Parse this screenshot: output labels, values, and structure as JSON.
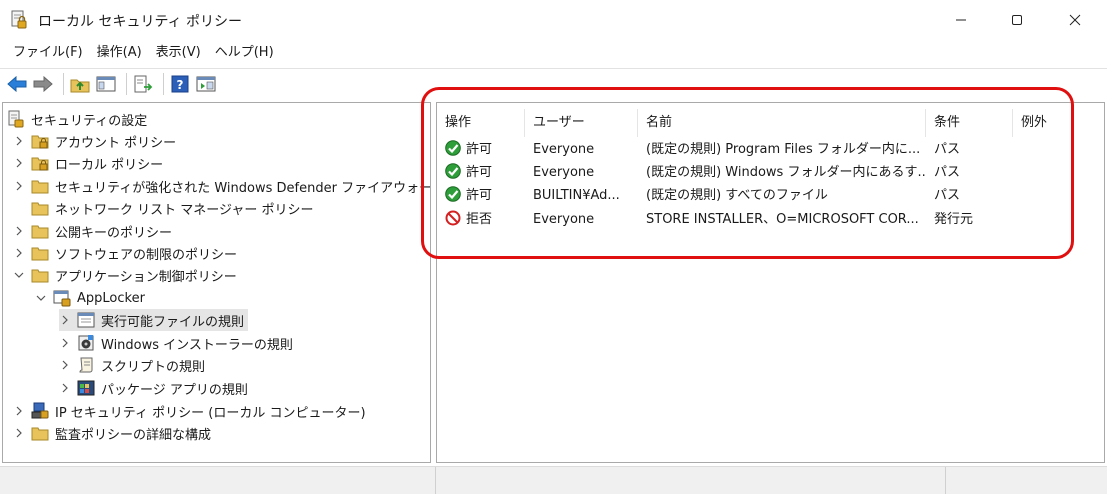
{
  "window": {
    "title": "ローカル セキュリティ ポリシー"
  },
  "menu": [
    {
      "label": "ファイル(F)"
    },
    {
      "label": "操作(A)"
    },
    {
      "label": "表示(V)"
    },
    {
      "label": "ヘルプ(H)"
    }
  ],
  "toolbar_icons": [
    "back-arrow-icon",
    "forward-arrow-icon",
    "up-folder-icon",
    "show-hide-tree-icon",
    "export-list-icon",
    "help-icon",
    "properties-icon"
  ],
  "tree": {
    "root": "セキュリティの設定",
    "items": [
      {
        "label": "アカウント ポリシー"
      },
      {
        "label": "ローカル ポリシー"
      },
      {
        "label": "セキュリティが強化された Windows Defender ファイアウォール"
      },
      {
        "label": "ネットワーク リスト マネージャー ポリシー"
      },
      {
        "label": "公開キーのポリシー"
      },
      {
        "label": "ソフトウェアの制限のポリシー"
      },
      {
        "label": "アプリケーション制御ポリシー"
      },
      {
        "label": "AppLocker"
      },
      {
        "label": "実行可能ファイルの規則"
      },
      {
        "label": "Windows インストーラーの規則"
      },
      {
        "label": "スクリプトの規則"
      },
      {
        "label": "パッケージ アプリの規則"
      },
      {
        "label": "IP セキュリティ ポリシー (ローカル コンピューター)"
      },
      {
        "label": "監査ポリシーの詳細な構成"
      }
    ]
  },
  "list": {
    "columns": {
      "action": "操作",
      "user": "ユーザー",
      "name": "名前",
      "condition": "条件",
      "exception": "例外"
    },
    "rows": [
      {
        "action": "許可",
        "user": "Everyone",
        "name": "(既定の規則) Program Files フォルダー内に...",
        "condition": "パス",
        "exception": ""
      },
      {
        "action": "許可",
        "user": "Everyone",
        "name": "(既定の規則) Windows フォルダー内にあるす...",
        "condition": "パス",
        "exception": ""
      },
      {
        "action": "許可",
        "user": "BUILTIN¥Ad...",
        "name": "(既定の規則) すべてのファイル",
        "condition": "パス",
        "exception": ""
      },
      {
        "action": "拒否",
        "user": "Everyone",
        "name": "STORE INSTALLER、O=MICROSOFT COR...",
        "condition": "発行元",
        "exception": ""
      }
    ]
  },
  "colors": {
    "allow": "#2e9e3a",
    "deny": "#d42020",
    "highlight": "#e01010",
    "folder": "#e8c25a"
  }
}
